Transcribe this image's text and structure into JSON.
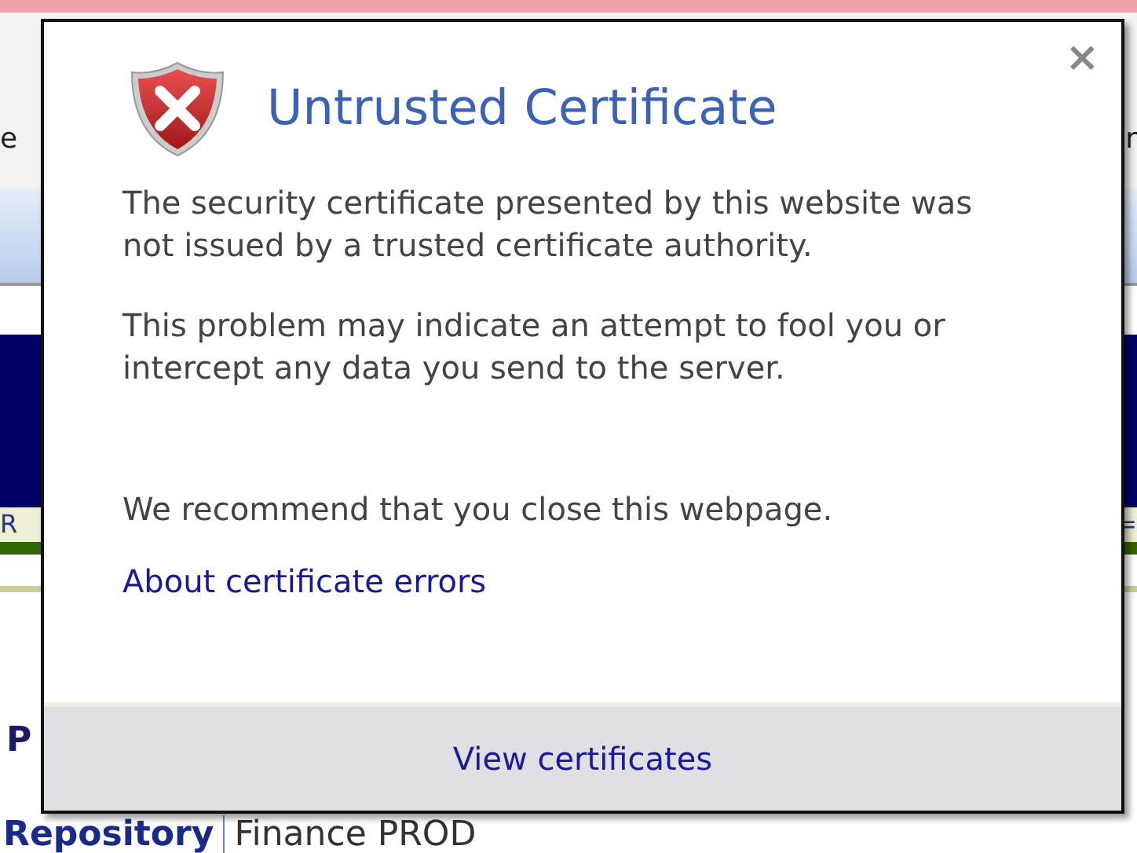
{
  "background": {
    "top_left": "e",
    "top_right": "r",
    "middle_left": "R",
    "middle_right": "=",
    "lower_left": "P",
    "breadcrumb": {
      "title": "Repository",
      "section": "Finance PROD"
    }
  },
  "dialog": {
    "title": "Untrusted Certificate",
    "close": "×",
    "paragraphs": [
      "The security certificate presented by this website was not issued by a trusted certificate authority.",
      "This problem may indicate an attempt to fool you or intercept any data you send to the server.",
      "We recommend that you close this webpage."
    ],
    "link": "About certificate errors",
    "footer_link": "View certificates"
  }
}
